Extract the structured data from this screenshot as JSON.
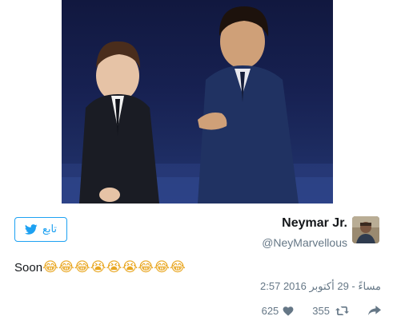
{
  "follow_button": {
    "label": "تابع",
    "icon": "twitter-bird-icon"
  },
  "author": {
    "display_name": "Neymar Jr.",
    "handle": "@NeyMarvellous",
    "avatar_icon": "avatar"
  },
  "tweet": {
    "text": "Soon",
    "emojis": "😂😂😂😭😭😭😂😂😂"
  },
  "timestamp": "2:57 مساءً - 29 أكتوبر 2016",
  "actions": {
    "likes": "625",
    "likes_icon": "heart-icon",
    "retweets": "355",
    "retweets_icon": "retweet-icon",
    "reply_icon": "reply-arrow-icon"
  },
  "colors": {
    "accent": "#1da1f2",
    "muted": "#657786",
    "text": "#14171a"
  }
}
